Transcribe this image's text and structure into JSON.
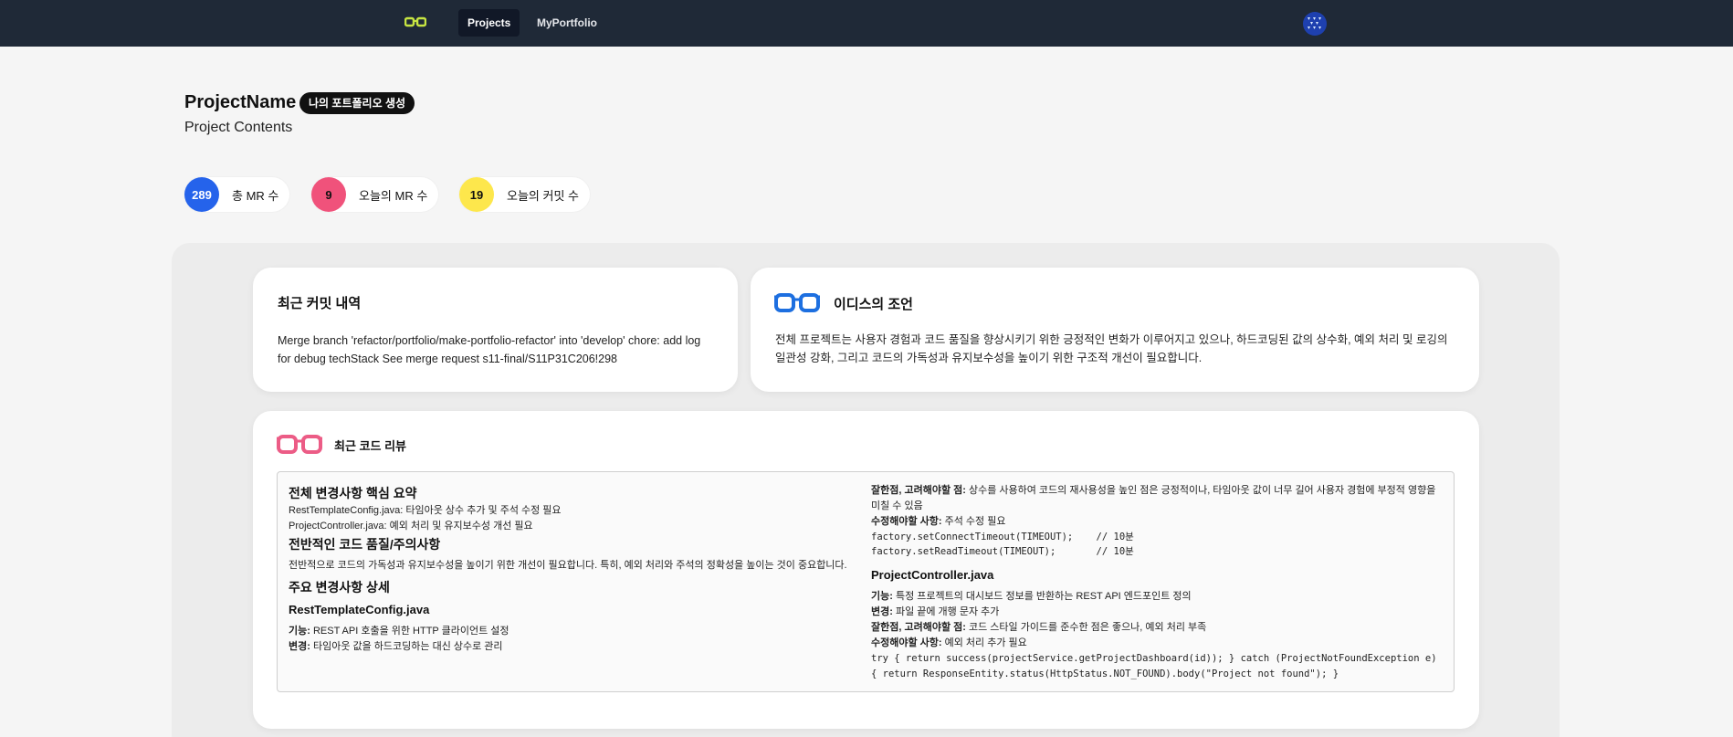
{
  "nav": {
    "tabs": [
      "Projects",
      "MyPortfolio"
    ],
    "logo_icon": "glasses-icon",
    "avatar_icon": "avatar-icon"
  },
  "project": {
    "name": "ProjectName",
    "badge": "나의 포트폴리오 생성",
    "subtitle": "Project Contents"
  },
  "stats": [
    {
      "value": "289",
      "label": "총 MR 수",
      "color": "#2563eb"
    },
    {
      "value": "9",
      "label": "오늘의 MR 수",
      "color": "#f0527b"
    },
    {
      "value": "19",
      "label": "오늘의 커밋 수",
      "color": "#fde74c"
    }
  ],
  "commit_card": {
    "title": "최근 커밋 내역",
    "body": "Merge branch 'refactor/portfolio/make-portfolio-refactor' into 'develop' chore: add log for debug techStack See merge request s11-final/S11P31C206!298"
  },
  "advice_card": {
    "title": "이디스의 조언",
    "icon": "blue-glasses-icon",
    "body": "전체 프로젝트는 사용자 경험과 코드 품질을 향상시키기 위한 긍정적인 변화가 이루어지고 있으나, 하드코딩된 값의 상수화, 예외 처리 및 로깅의 일관성 강화, 그리고 코드의 가독성과 유지보수성을 높이기 위한 구조적 개선이 필요합니다."
  },
  "review_card": {
    "title": "최근 코드 리뷰",
    "icon": "pink-glasses-icon",
    "left": {
      "summary_heading": "전체 변경사항 핵심 요약",
      "summary_lines": [
        "RestTemplateConfig.java: 타임아웃 상수 추가 및 주석 수정 필요",
        "ProjectController.java: 예외 처리 및 유지보수성 개선 필요"
      ],
      "quality_heading": "전반적인 코드 품질/주의사항",
      "quality_text": "전반적으로 코드의 가독성과 유지보수성을 높이기 위한 개선이 필요합니다. 특히, 예외 처리와 주석의 정확성을 높이는 것이 중요합니다.",
      "detail_heading": "주요 변경사항 상세",
      "file1_name": "RestTemplateConfig.java",
      "file1_func_label": "기능:",
      "file1_func": "REST API 호출을 위한 HTTP 클라이언트 설정",
      "file1_change_label": "변경:",
      "file1_change": "타임아웃 값을 하드코딩하는 대신 상수로 관리"
    },
    "right": {
      "good_label": "잘한점, 고려해야할 점:",
      "good_text": "상수를 사용하여 코드의 재사용성을 높인 점은 긍정적이나, 타임아웃 값이 너무 길어 사용자 경험에 부정적 영향을 미칠 수 있음",
      "fix_label": "수정해야할 사항:",
      "fix_text": "주석 수정 필요",
      "code1": "factory.setConnectTimeout(TIMEOUT);    // 10분",
      "code2": "factory.setReadTimeout(TIMEOUT);       // 10분",
      "file2_name": "ProjectController.java",
      "file2_func_label": "기능:",
      "file2_func": "특정 프로젝트의 대시보드 정보를 반환하는 REST API 엔드포인트 정의",
      "file2_change_label": "변경:",
      "file2_change": "파일 끝에 개행 문자 추가",
      "file2_good_label": "잘한점, 고려해야할 점:",
      "file2_good": "코드 스타일 가이드를 준수한 점은 좋으나, 예외 처리 부족",
      "file2_fix_label": "수정해야할 사항:",
      "file2_fix": "예외 처리 추가 필요",
      "code3": "try { return success(projectService.getProjectDashboard(id)); } catch (ProjectNotFoundException e) { return ResponseEntity.status(HttpStatus.NOT_FOUND).body(\"Project not found\"); }"
    }
  }
}
